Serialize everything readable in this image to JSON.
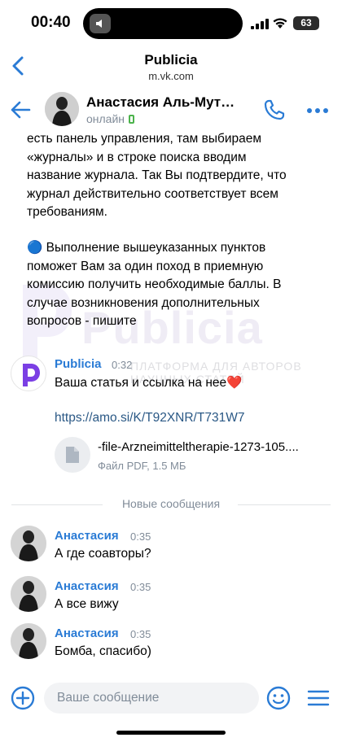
{
  "status_bar": {
    "time": "00:40",
    "battery": "63"
  },
  "browser": {
    "site_name": "Publicia",
    "url": "m.vk.com"
  },
  "chat": {
    "contact_name": "Анастасия Аль-Мут…",
    "status": "онлайн"
  },
  "prev_message_lines": [
    "есть панель управления, там выбираем",
    "«журналы» и в строке поиска вводим",
    "название журнала. Так Вы подтвердите, что",
    "журнал действительно соответствует всем",
    "требованиям.",
    "",
    "🔵 Выполнение вышеуказанных пунктов",
    "поможет Вам за один поход в приемную",
    "комиссию получить необходимые баллы. В",
    "случае возникновения дополнительных",
    "вопросов - пишите"
  ],
  "watermark": {
    "title": "Publicia",
    "subtitle": "ПЛАТФОРМА ДЛЯ АВТОРОВ НАУЧНЫХ СТАТЕЙ"
  },
  "publicia_message": {
    "sender": "Publicia",
    "time": "0:32",
    "text": "Ваша статья и ссылка на нее❤️",
    "link": "https://amo.si/K/T92XNR/T731W7",
    "file_name": "-file-Arzneimitteltherapie-1273-105....",
    "file_meta": "Файл PDF, 1.5 МБ"
  },
  "divider_label": "Новые сообщения",
  "replies": [
    {
      "sender": "Анастасия",
      "time": "0:35",
      "text": "А где соавторы?"
    },
    {
      "sender": "Анастасия",
      "time": "0:35",
      "text": "А все вижу"
    },
    {
      "sender": "Анастасия",
      "time": "0:35",
      "text": "Бомба, спасибо)"
    }
  ],
  "composer": {
    "placeholder": "Ваше сообщение"
  },
  "colors": {
    "accent": "#2a7bd5",
    "link": "#2a5885",
    "online": "#4bb34b",
    "publicia": "#7b3fe4"
  }
}
